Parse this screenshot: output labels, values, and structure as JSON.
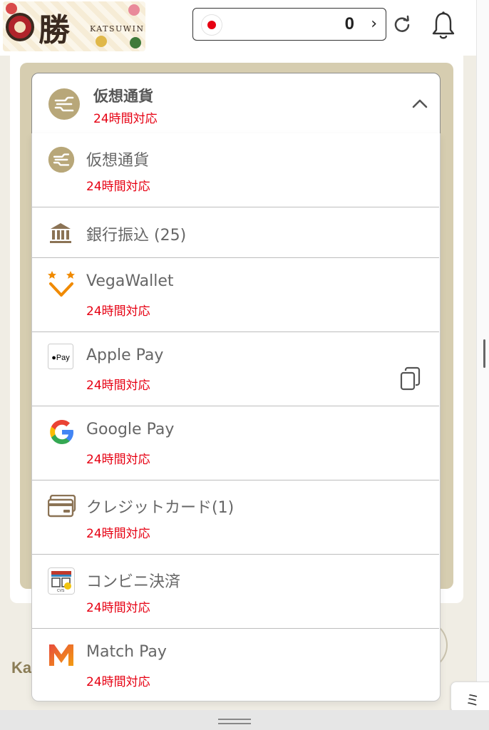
{
  "header": {
    "logo_kanji": "勝",
    "logo_text": "KATSUWIN",
    "balance_value": "0",
    "balance_chevron": "›"
  },
  "payment_select": {
    "selected_title": "仮想通貨",
    "selected_sub": "24時間対応",
    "options": [
      {
        "title": "仮想通貨",
        "sub": "24時間対応",
        "icon": "crypto-icon"
      },
      {
        "title": "銀行振込 (25)",
        "sub": "",
        "icon": "bank-icon"
      },
      {
        "title": "VegaWallet",
        "sub": "24時間対応",
        "icon": "vegawallet-icon"
      },
      {
        "title": "Apple Pay",
        "sub": "24時間対応",
        "icon": "apple-pay-icon"
      },
      {
        "title": "Google Pay",
        "sub": "24時間対応",
        "icon": "google-icon"
      },
      {
        "title": "クレジットカード(1)",
        "sub": "24時間対応",
        "icon": "credit-card-icon"
      },
      {
        "title": "コンビニ決済",
        "sub": "24時間対応",
        "icon": "convenience-store-icon"
      },
      {
        "title": "Match Pay",
        "sub": "24時間対応",
        "icon": "match-pay-icon"
      }
    ]
  },
  "footer": {
    "text": "Ka"
  },
  "side_tab": {
    "label": "ミ"
  },
  "colors": {
    "accent_red": "#e60012",
    "gold": "#b8a779",
    "panel": "#d6cdb0"
  }
}
